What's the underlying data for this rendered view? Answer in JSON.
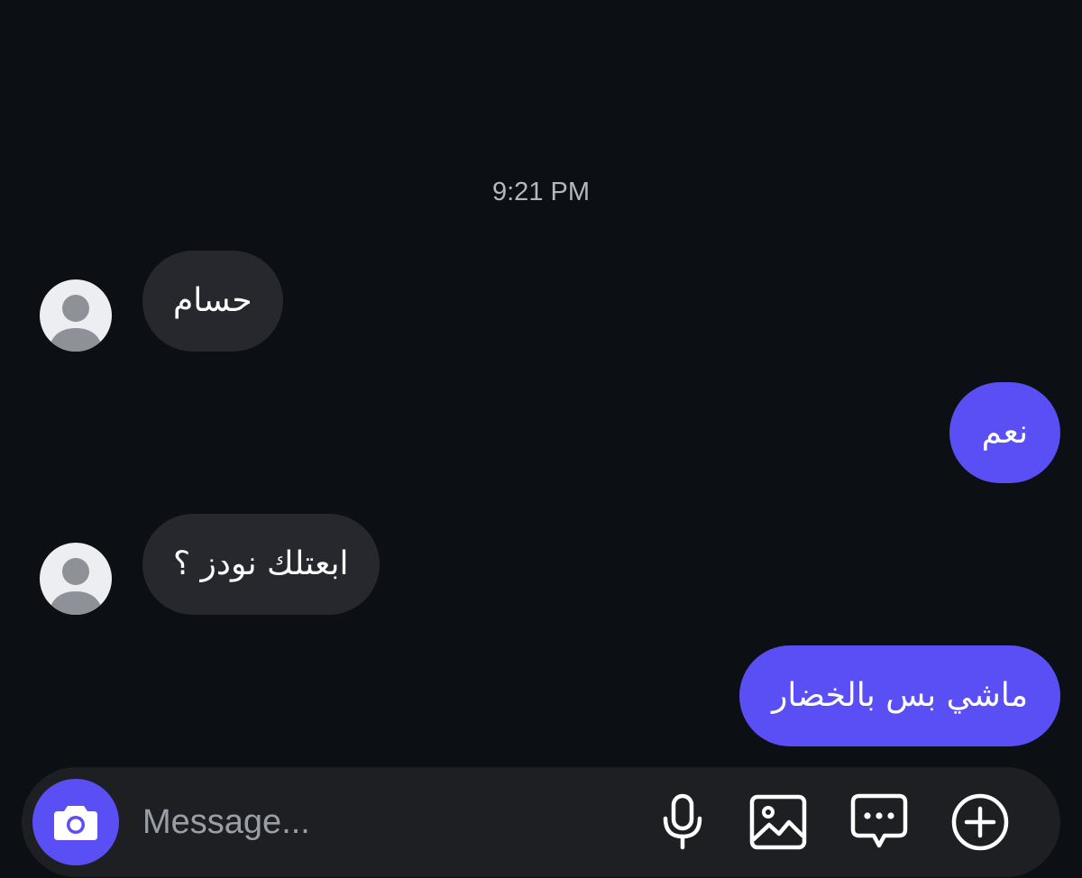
{
  "thread": {
    "timestamp": "9:21 PM",
    "messages": [
      {
        "direction": "incoming",
        "text": "حسام"
      },
      {
        "direction": "outgoing",
        "text": "نعم"
      },
      {
        "direction": "incoming",
        "text": "ابعتلك نودز ؟"
      },
      {
        "direction": "outgoing",
        "text": "ماشي بس بالخضار"
      }
    ]
  },
  "composer": {
    "placeholder": "Message...",
    "camera_icon": "camera-icon",
    "tools": [
      "microphone-icon",
      "gallery-icon",
      "sticker-chat-icon",
      "add-circle-icon"
    ]
  },
  "colors": {
    "background": "#0c0f14",
    "incoming_bubble": "#26282d",
    "outgoing_bubble": "#5a4ef5",
    "accent": "#5a4ef5"
  }
}
